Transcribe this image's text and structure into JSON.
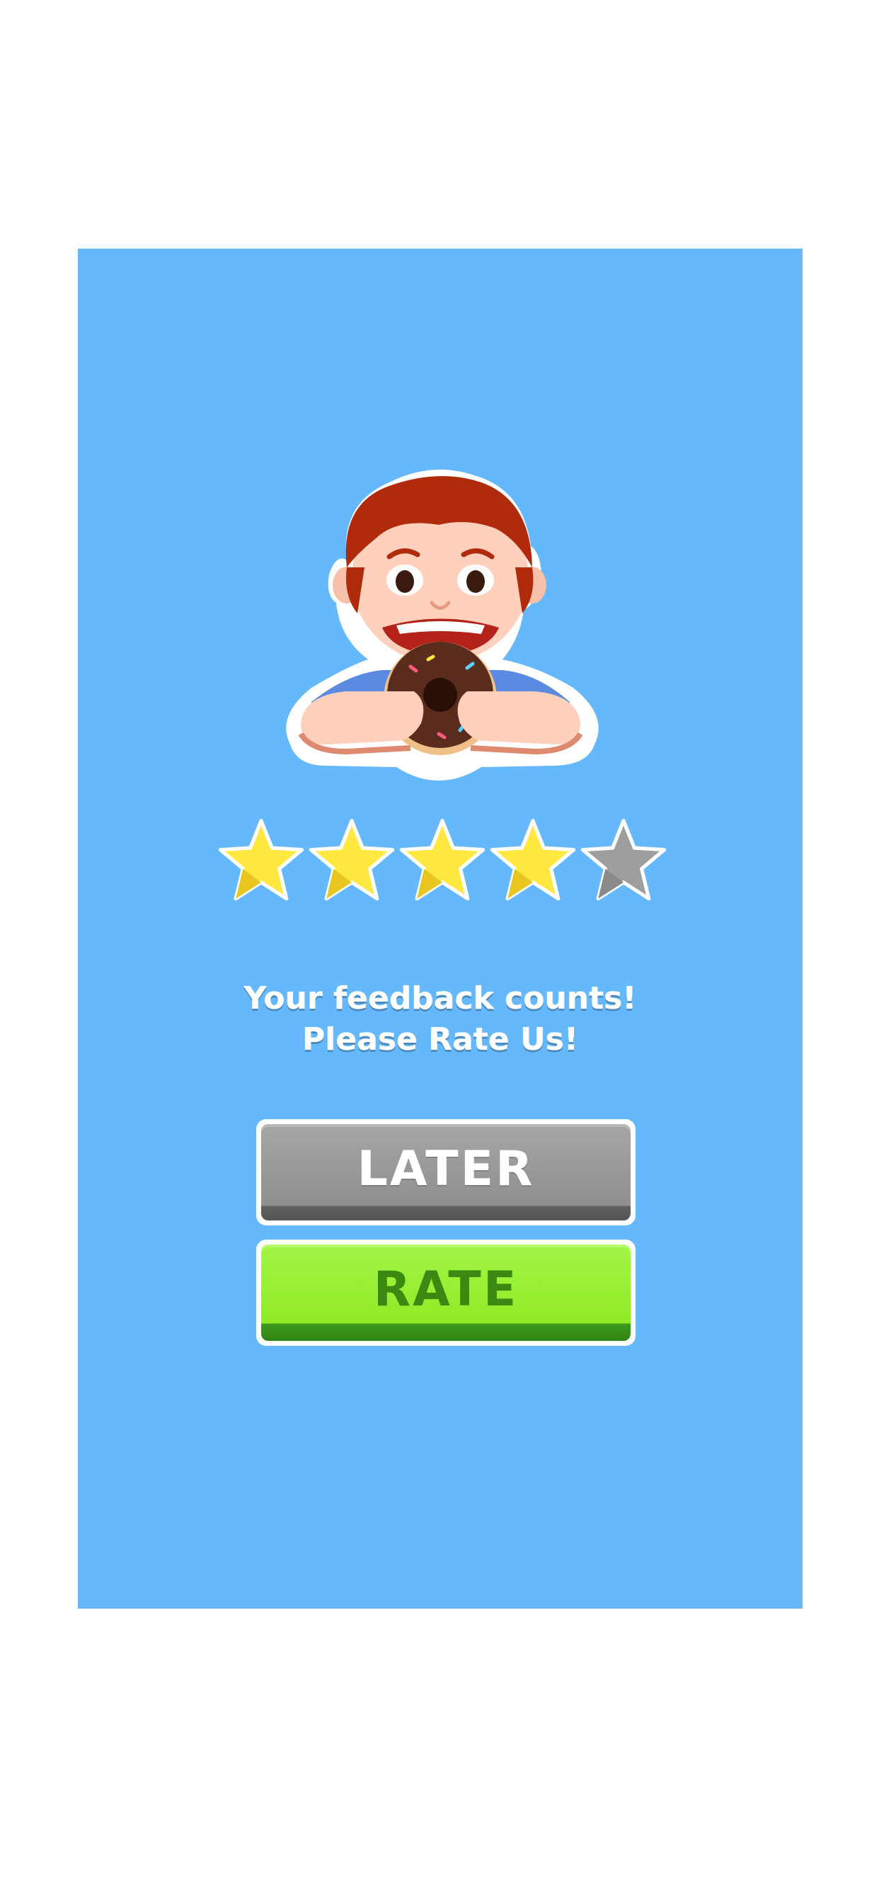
{
  "dialog": {
    "message_line1": "Your feedback counts!",
    "message_line2": "Please Rate Us!",
    "rating": {
      "filled": 4,
      "total": 5
    }
  },
  "buttons": {
    "later_label": "LATER",
    "rate_label": "RATE"
  },
  "colors": {
    "background": "#64b8fb",
    "star_filled": "#ffe840",
    "star_empty": "#9e9e9e",
    "later_button": "#9b9b9b",
    "rate_button": "#98ee34",
    "rate_text": "#3a8a12"
  },
  "icons": {
    "mascot": "boy-eating-donut-icon",
    "star": "star-icon"
  }
}
